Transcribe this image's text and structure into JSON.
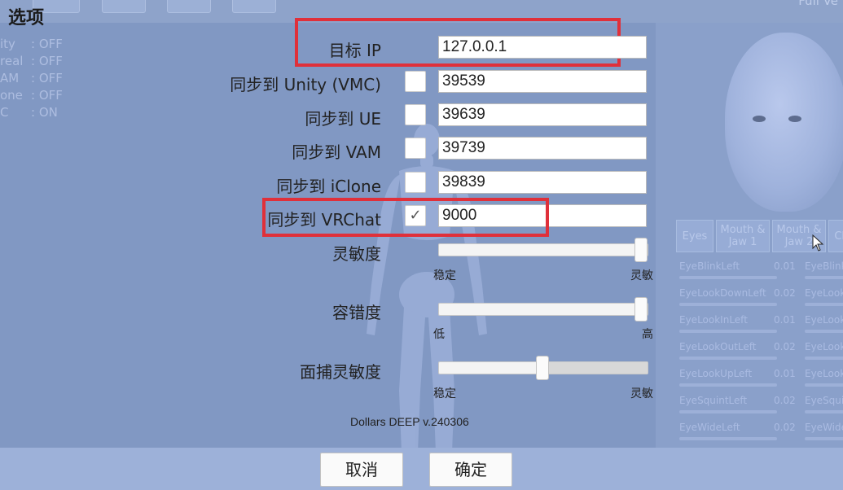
{
  "dialog": {
    "title": "选项"
  },
  "top_right_text": "Full Ve",
  "status_list": [
    {
      "name": "ity",
      "value": ": OFF"
    },
    {
      "name": "real",
      "value": ": OFF"
    },
    {
      "name": "AM",
      "value": ": OFF"
    },
    {
      "name": "one",
      "value": ": OFF"
    },
    {
      "name": "C",
      "value": ": ON"
    }
  ],
  "form": {
    "target_ip": {
      "label": "目标 IP",
      "value": "127.0.0.1"
    },
    "sync_rows": [
      {
        "label": "同步到 Unity (VMC)",
        "checked": false,
        "check_text": "",
        "port": "39539"
      },
      {
        "label": "同步到 UE",
        "checked": false,
        "check_text": "",
        "port": "39639"
      },
      {
        "label": "同步到 VAM",
        "checked": false,
        "check_text": "",
        "port": "39739"
      },
      {
        "label": "同步到 iClone",
        "checked": false,
        "check_text": "",
        "port": "39839"
      },
      {
        "label": "同步到 VRChat",
        "checked": true,
        "check_text": "✓",
        "port": "9000"
      }
    ],
    "sliders": [
      {
        "label": "灵敏度",
        "min_label": "稳定",
        "max_label": "灵敏",
        "level": 1.0
      },
      {
        "label": "容错度",
        "min_label": "低",
        "max_label": "高",
        "level": 1.0
      },
      {
        "label": "面捕灵敏度",
        "min_label": "稳定",
        "max_label": "灵敏",
        "level": 0.5
      }
    ]
  },
  "version": "Dollars DEEP v.240306",
  "buttons": {
    "cancel": "取消",
    "ok": "确定"
  },
  "blendshape_tabs": [
    "Eyes",
    "Mouth & Jaw 1",
    "Mouth & Jaw 2",
    "Ch"
  ],
  "blendshapes": [
    {
      "name": "EyeBlinkLeft",
      "value": "0.01",
      "name2": "EyeBlink"
    },
    {
      "name": "EyeLookDownLeft",
      "value": "0.02",
      "name2": "EyeLook"
    },
    {
      "name": "EyeLookInLeft",
      "value": "0.01",
      "name2": "EyeLook"
    },
    {
      "name": "EyeLookOutLeft",
      "value": "0.02",
      "name2": "EyeLook"
    },
    {
      "name": "EyeLookUpLeft",
      "value": "0.01",
      "name2": "EyeLook"
    },
    {
      "name": "EyeSquintLeft",
      "value": "0.02",
      "name2": "EyeSqui"
    },
    {
      "name": "EyeWideLeft",
      "value": "0.02",
      "name2": "EyeWide"
    }
  ],
  "colors": {
    "highlight": "#e0303a",
    "background": "#8198c3"
  }
}
